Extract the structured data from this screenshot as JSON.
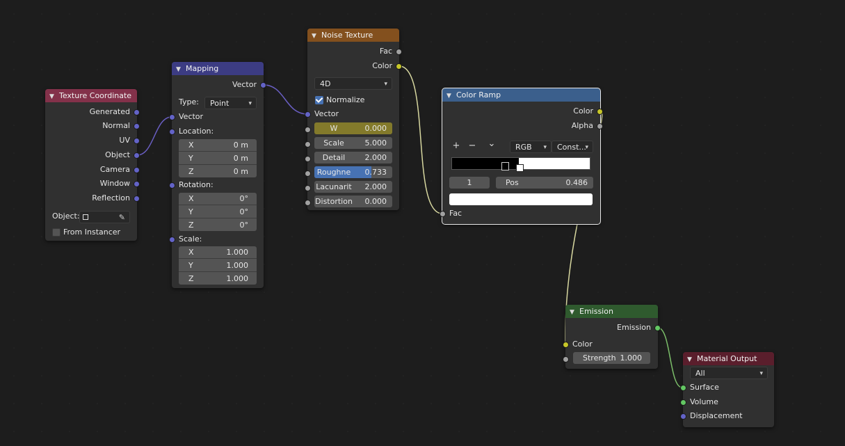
{
  "nodes": {
    "texture_coordinate": {
      "title": "Texture Coordinate",
      "header_color": "#83314a",
      "outputs": [
        "Generated",
        "Normal",
        "UV",
        "Object",
        "Camera",
        "Window",
        "Reflection"
      ],
      "object_label": "Object:",
      "from_instancer": "From Instancer"
    },
    "mapping": {
      "title": "Mapping",
      "header_color": "#3c3c83",
      "output": "Vector",
      "type_label": "Type:",
      "type_value": "Point",
      "vector_input": "Vector",
      "location_label": "Location:",
      "location": [
        {
          "axis": "X",
          "value": "0 m"
        },
        {
          "axis": "Y",
          "value": "0 m"
        },
        {
          "axis": "Z",
          "value": "0 m"
        }
      ],
      "rotation_label": "Rotation:",
      "rotation": [
        {
          "axis": "X",
          "value": "0°"
        },
        {
          "axis": "Y",
          "value": "0°"
        },
        {
          "axis": "Z",
          "value": "0°"
        }
      ],
      "scale_label": "Scale:",
      "scale": [
        {
          "axis": "X",
          "value": "1.000"
        },
        {
          "axis": "Y",
          "value": "1.000"
        },
        {
          "axis": "Z",
          "value": "1.000"
        }
      ]
    },
    "noise_texture": {
      "title": "Noise Texture",
      "header_color": "#83501e",
      "outputs": [
        "Fac",
        "Color"
      ],
      "dimensions": "4D",
      "normalize": "Normalize",
      "vector_input": "Vector",
      "fields": [
        {
          "label": "W",
          "value": "0.000"
        },
        {
          "label": "Scale",
          "value": "5.000"
        },
        {
          "label": "Detail",
          "value": "2.000"
        },
        {
          "label": "Roughne",
          "value": "0.733"
        },
        {
          "label": "Lacunarit",
          "value": "2.000"
        },
        {
          "label": "Distortion",
          "value": "0.000"
        }
      ],
      "w_color": "#837a2b",
      "roughness_fill": 0.733,
      "roughness_color": "#4772b3"
    },
    "color_ramp": {
      "title": "Color Ramp",
      "header_color": "#3b5f8c",
      "outputs": [
        "Color",
        "Alpha"
      ],
      "add_symbol": "+",
      "remove_symbol": "−",
      "menu_symbol": "⌄",
      "color_mode": "RGB",
      "interpolation": "Const...",
      "stop_index": "1",
      "pos_label": "Pos",
      "pos_value": "0.486",
      "fac_input": "Fac"
    },
    "emission": {
      "title": "Emission",
      "header_color": "#2f5a2e",
      "output": "Emission",
      "color_input": "Color",
      "strength_label": "Strength",
      "strength_value": "1.000"
    },
    "material_output": {
      "title": "Material Output",
      "header_color": "#5a1e2c",
      "target": "All",
      "inputs": [
        "Surface",
        "Volume",
        "Displacement"
      ]
    }
  }
}
